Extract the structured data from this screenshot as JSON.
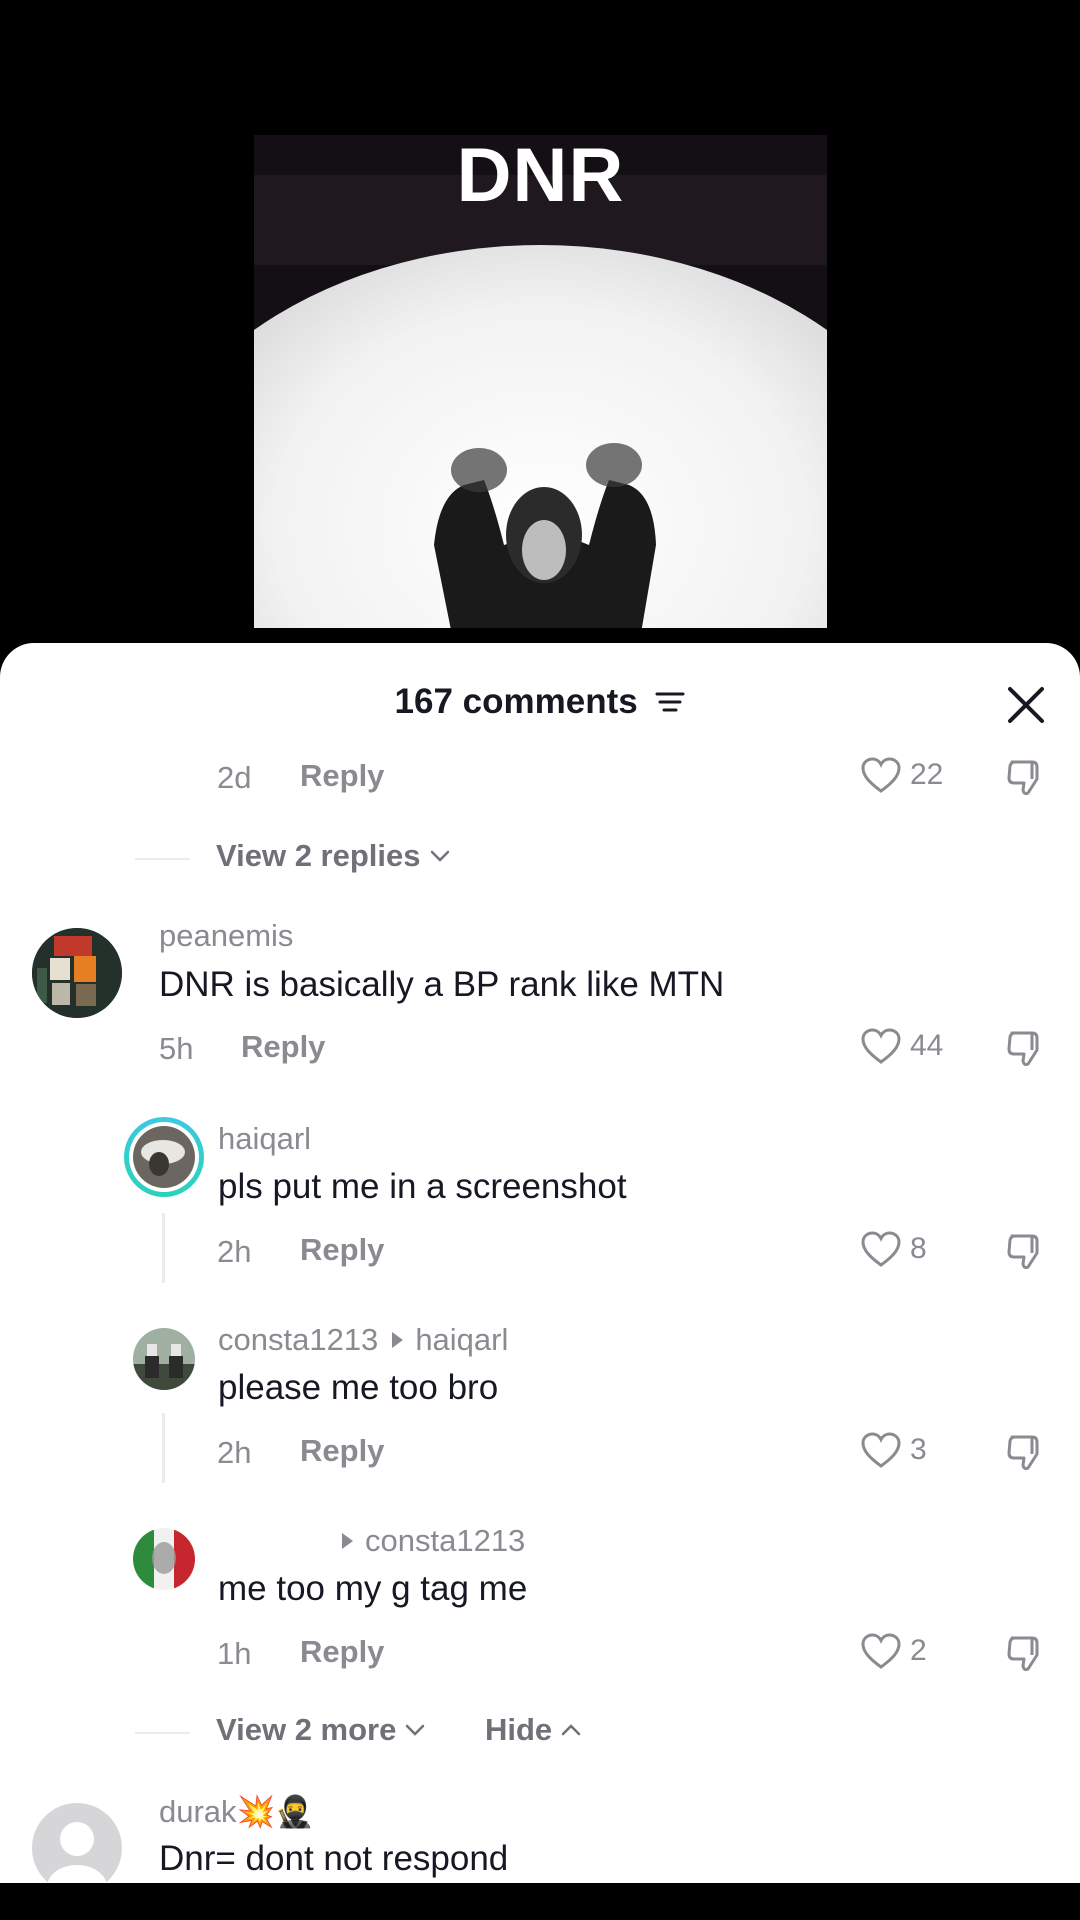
{
  "video": {
    "title": "DNR"
  },
  "sheet": {
    "comment_count": "167 comments",
    "icons": {
      "filter": "filter-icon",
      "close": "close-icon",
      "like": "heart-icon",
      "dislike": "dislike-icon"
    }
  },
  "top_comment": {
    "time": "2d",
    "reply": "Reply",
    "likes": "22"
  },
  "view_replies_1": {
    "label": "View 2 replies"
  },
  "comments": [
    {
      "username": "peanemis",
      "text": "DNR is basically a BP rank like MTN",
      "time": "5h",
      "reply": "Reply",
      "likes": "44"
    }
  ],
  "replies": [
    {
      "username": "haiqarl",
      "text": "pls put me in a screenshot",
      "time": "2h",
      "reply": "Reply",
      "likes": "8"
    },
    {
      "username": "consta1213",
      "reply_to": "haiqarl",
      "text": "please me too bro",
      "time": "2h",
      "reply": "Reply",
      "likes": "3"
    },
    {
      "username": "",
      "reply_to": "consta1213",
      "text": "me too my g tag me",
      "time": "1h",
      "reply": "Reply",
      "likes": "2"
    }
  ],
  "view_more": {
    "label": "View 2 more",
    "hide": "Hide"
  },
  "last_comment": {
    "username": "durak💥🥷",
    "text": "Dnr= dont not respond"
  }
}
